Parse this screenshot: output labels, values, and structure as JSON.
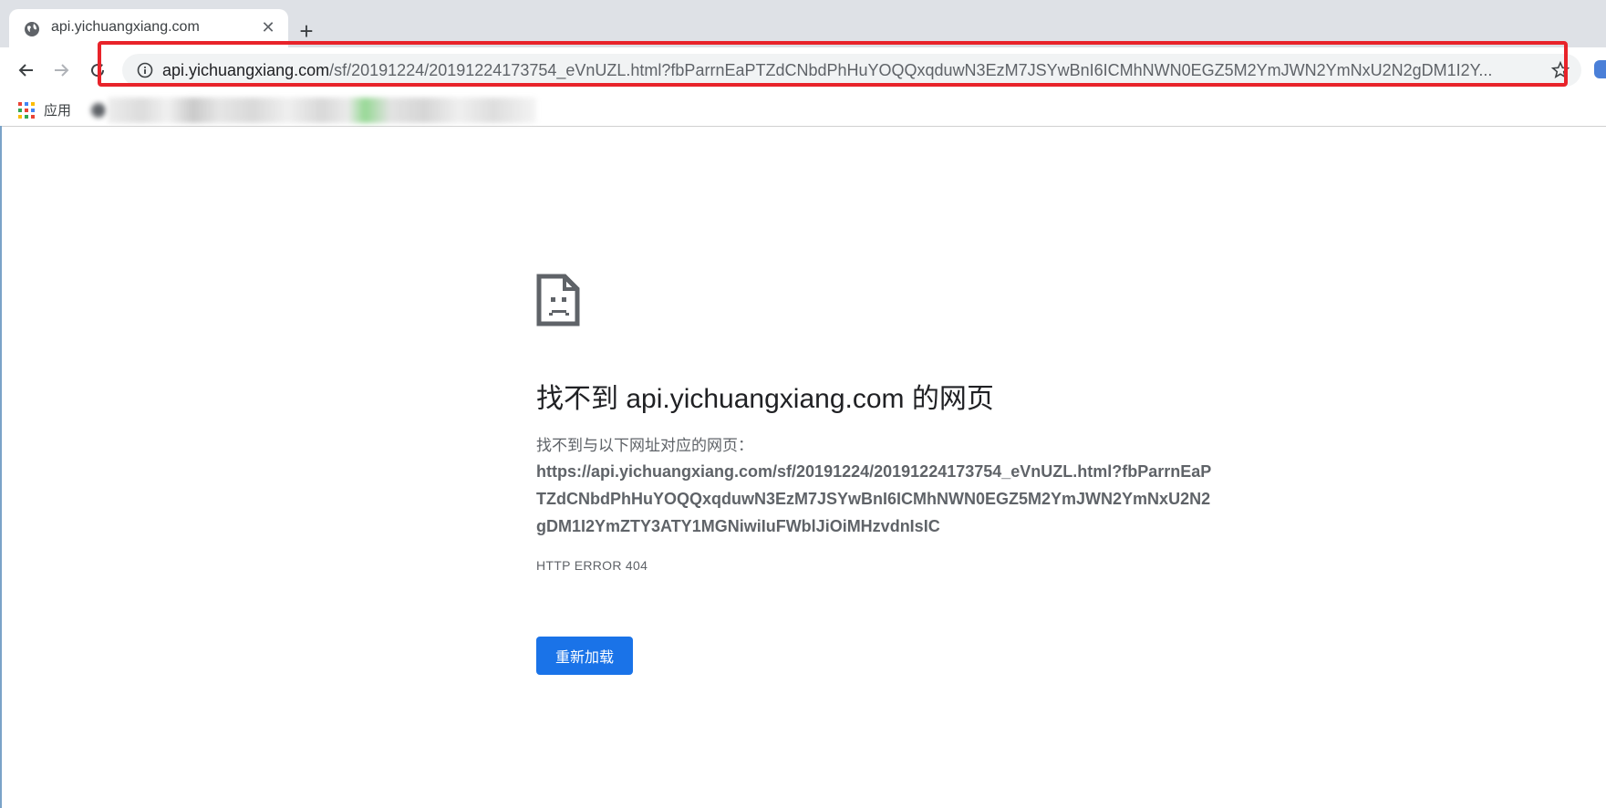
{
  "tab": {
    "title": "api.yichuangxiang.com",
    "close_glyph": "✕",
    "favicon": "globe-icon"
  },
  "new_tab_glyph": "+",
  "toolbar": {
    "icons": [
      "back-icon",
      "forward-icon",
      "reload-icon",
      "info-icon",
      "star-icon"
    ]
  },
  "address_bar": {
    "host": "api.yichuangxiang.com",
    "path": "/sf/20191224/20191224173754_eVnUZL.html?fbParrnEaPTZdCNbdPhHuYOQQxqduwN3EzM7JSYwBnI6ICMhNWN0EGZ5M2YmJWN2YmNxU2N2gDM1I2Y..."
  },
  "highlight_color": "#e8232a",
  "bookmarks": {
    "apps_label": "应用"
  },
  "error_page": {
    "icon": "sad-page-icon",
    "heading": "找不到 api.yichuangxiang.com 的网页",
    "description": "找不到与以下网址对应的网页：",
    "url": "https://api.yichuangxiang.com/sf/20191224/20191224173754_eVnUZL.html?fbParrnEaPTZdCNbdPhHuYOQQxqduwN3EzM7JSYwBnI6ICMhNWN0EGZ5M2YmJWN2YmNxU2N2gDM1I2YmZTY3ATY1MGNiwiIuFWblJiOiMHzvdnIsIC",
    "error_code": "HTTP ERROR 404",
    "reload_label": "重新加载",
    "button_color": "#1a73e8"
  }
}
